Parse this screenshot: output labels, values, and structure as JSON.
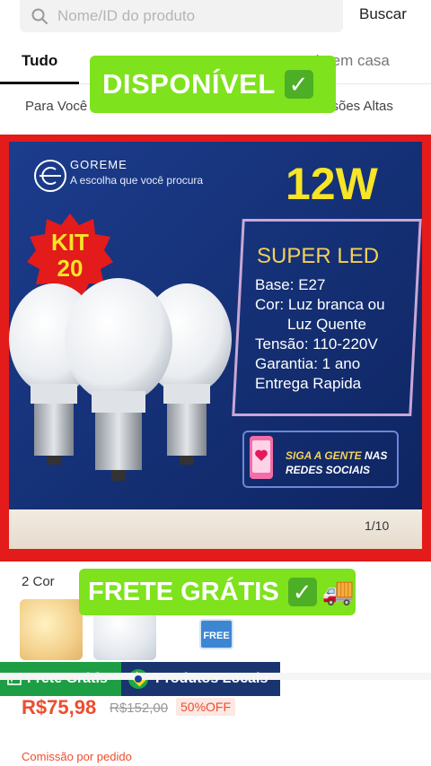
{
  "search": {
    "placeholder": "Nome/ID do produto",
    "button_label": "Buscar"
  },
  "tabs": [
    {
      "label": "Tudo",
      "active": true
    },
    {
      "label": "da em casa",
      "active": false
    }
  ],
  "subtabs": [
    {
      "label": "Para Você"
    },
    {
      "label": "ssões Altas"
    }
  ],
  "overlays": {
    "top_label": "DISPONÍVEL",
    "bottom_label": "FRETE GRÁTIS",
    "check_icon": "✓",
    "truck_icon": "🚚",
    "accent_color": "#7ee21c"
  },
  "product_image": {
    "brand_name": "GOREME",
    "brand_tagline": "A escolha que você procura",
    "wattage": "12W",
    "kit_line1": "KIT",
    "kit_line2": "20",
    "spec_title": "SUPER LED",
    "spec_lines": [
      "Base: E27",
      "Cor: Luz branca ou",
      "Luz Quente",
      "Tensão: 110-220V",
      "Garantia: 1 ano",
      "Entrega Rapida"
    ],
    "social_line1_a": "SIGA A GENTE",
    "social_line1_b": "NAS",
    "social_line2": "REDES SOCIAIS",
    "page_indicator": "1/10"
  },
  "shipping_badges": {
    "free_shipping": "Frete Grátis",
    "local_products": "Produtos Locais"
  },
  "variants": {
    "count_label": "2 Cor",
    "free_badge": "FREE"
  },
  "price": {
    "current": "R$75,98",
    "original": "R$152,00",
    "discount": "50%OFF",
    "commission_label": "Comissão por pedido"
  }
}
